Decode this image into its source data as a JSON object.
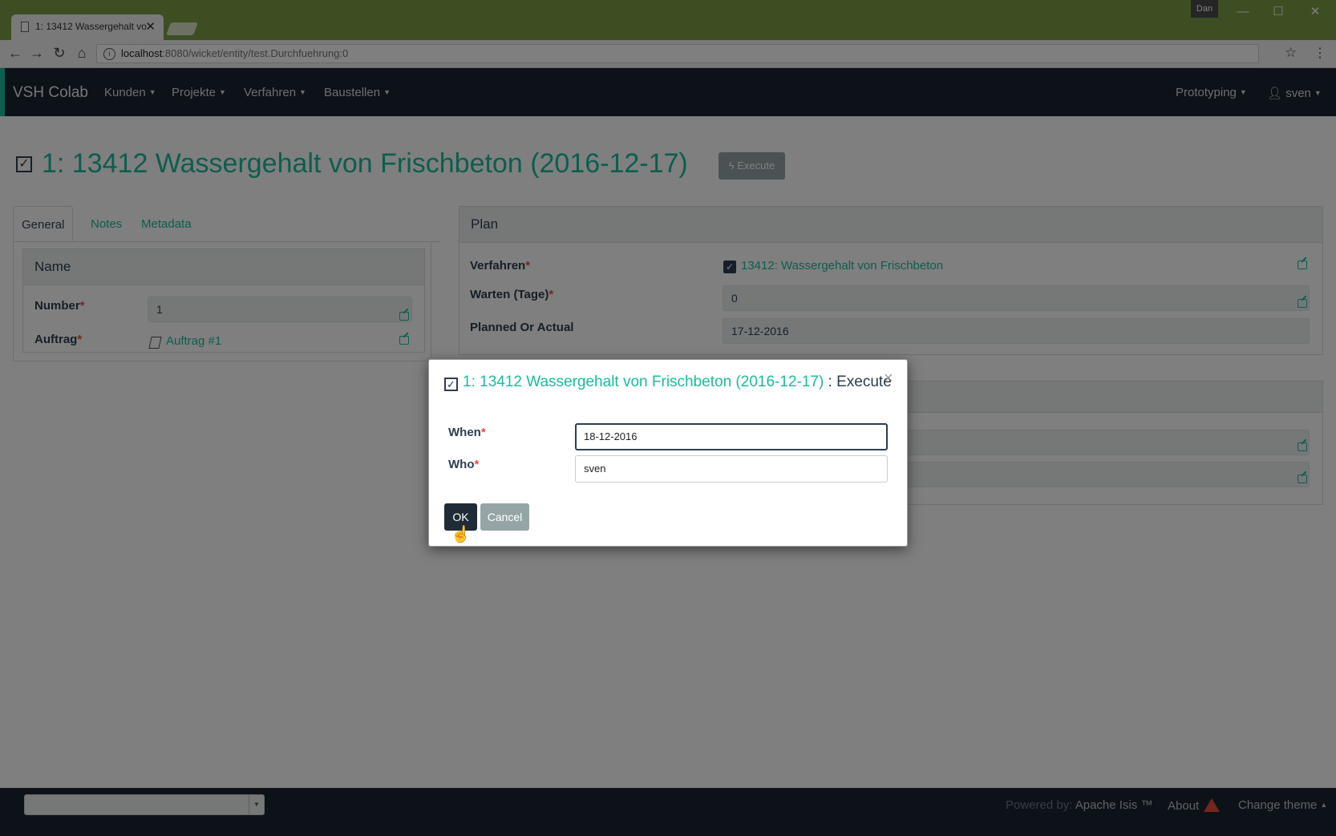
{
  "browser": {
    "tab_title": "1: 13412 Wassergehalt vo",
    "user_chip": "Dan",
    "url_host": "localhost",
    "url_path": ":8080/wicket/entity/test.Durchfuehrung:0",
    "win_min": "—",
    "win_max": "☐",
    "win_close": "✕"
  },
  "navbar": {
    "brand": "VSH Colab",
    "menus": [
      "Kunden",
      "Projekte",
      "Verfahren",
      "Baustellen"
    ],
    "right_menus": [
      "Prototyping",
      "sven"
    ]
  },
  "page": {
    "title": "1: 13412 Wassergehalt von Frischbeton (2016-12-17)",
    "execute_label": "Execute",
    "tabs": [
      "General",
      "Notes",
      "Metadata"
    ]
  },
  "name_panel": {
    "heading": "Name",
    "fields": [
      {
        "label": "Number",
        "value": "1"
      },
      {
        "label": "Auftrag",
        "value": "Auftrag #1"
      }
    ]
  },
  "plan_panel": {
    "heading": "Plan",
    "fields": [
      {
        "label": "Verfahren",
        "value": "13412: Wassergehalt von Frischbeton"
      },
      {
        "label": "Warten (Tage)",
        "value": "0"
      },
      {
        "label": "Planned Or Actual",
        "value": "17-12-2016"
      }
    ]
  },
  "modal": {
    "title": "1: 13412 Wassergehalt von Frischbeton (2016-12-17)",
    "separator": " : ",
    "action": "Execute",
    "close": "×",
    "fields": [
      {
        "label": "When",
        "value": "18-12-2016"
      },
      {
        "label": "Who",
        "value": "sven"
      }
    ],
    "ok_label": "OK",
    "cancel_label": "Cancel"
  },
  "footer": {
    "powered_by": "Powered by:",
    "apache": "Apache Isis ™",
    "about": "About",
    "change_theme": "Change theme"
  },
  "required_marker": "*",
  "colors": {
    "accent": "#18bc9c",
    "navbar": "#1a2530",
    "chrome": "#7a9c47",
    "danger": "#e74c3c"
  }
}
